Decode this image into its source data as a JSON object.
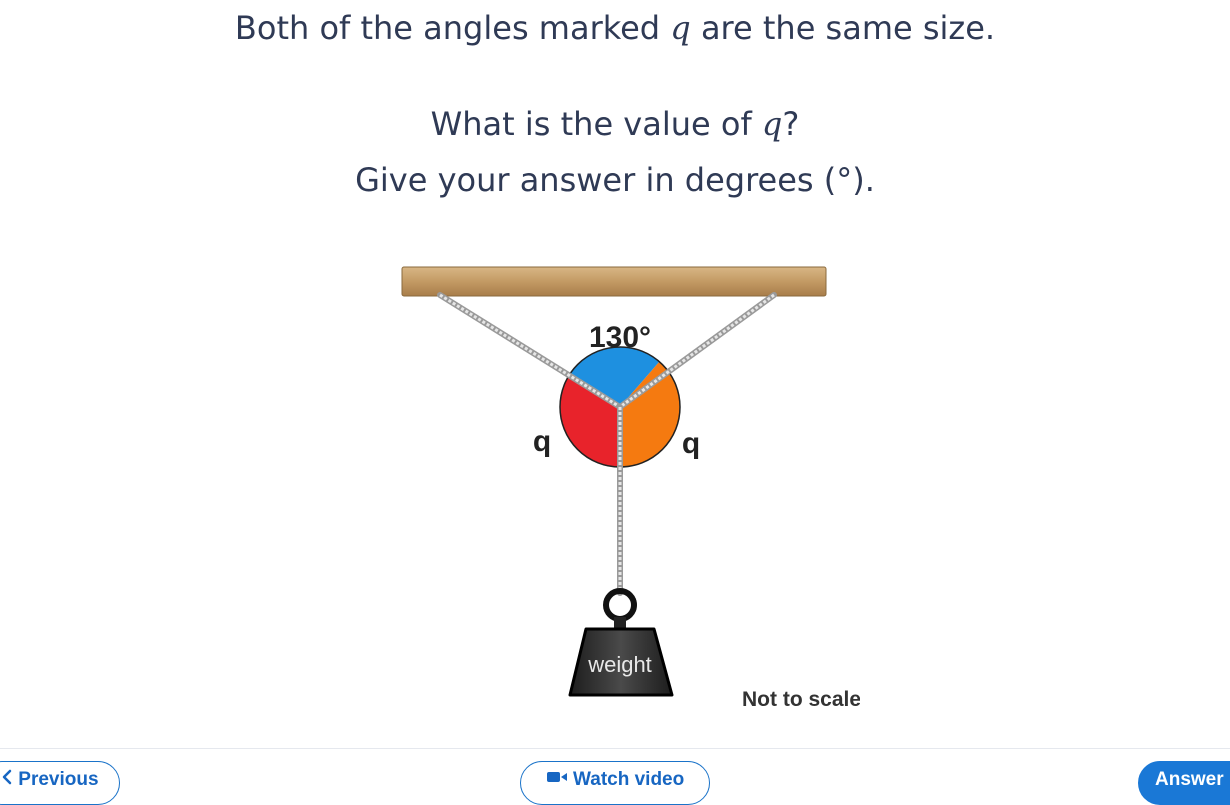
{
  "question": {
    "line1_before": "Both of the angles marked ",
    "line1_var": "q",
    "line1_after": " are the same size.",
    "line2_before": "What is the value of ",
    "line2_var": "q",
    "line2_after": "?",
    "line3_before": "Give your answer in degrees ",
    "line3_unit": "(°)",
    "line3_after": "."
  },
  "diagram": {
    "top_angle_label": "130°",
    "left_angle_label": "q",
    "right_angle_label": "q",
    "weight_label": "weight",
    "note": "Not to scale",
    "colors": {
      "top_sector": "#1e90e0",
      "left_sector": "#e8232b",
      "right_sector": "#f57a10",
      "bar": "#c49a63",
      "weight": "#2b2b2b"
    }
  },
  "nav": {
    "previous_label": "Previous",
    "watch_video_label": "Watch video",
    "answer_label": "Answer"
  },
  "accent_color": "#1a73c9"
}
